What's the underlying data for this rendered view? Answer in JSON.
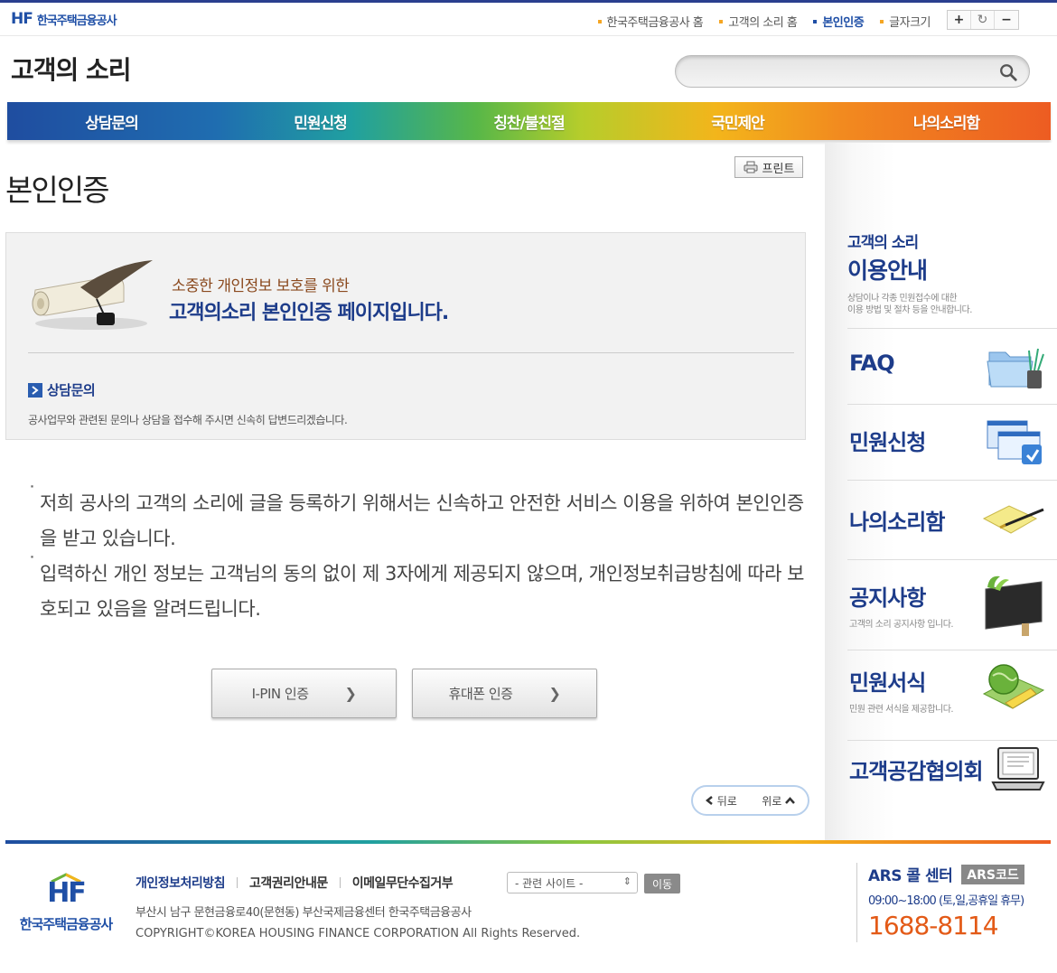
{
  "top": {
    "logo_mark": "HF",
    "logo_name": "한국주택금융공사",
    "utility": [
      {
        "label": "한국주택금융공사 홈",
        "active": false
      },
      {
        "label": "고객의 소리 홈",
        "active": false
      },
      {
        "label": "본인인증",
        "active": true
      },
      {
        "label": "글자크기",
        "active": false
      }
    ],
    "fontsize": {
      "plus": "+",
      "reset": "↻",
      "minus": "−"
    }
  },
  "header": {
    "title": "고객의 소리",
    "search_placeholder": ""
  },
  "gnb": [
    "상담문의",
    "민원신청",
    "칭찬/불친절",
    "국민제안",
    "나의소리함"
  ],
  "main": {
    "title": "본인인증",
    "print_label": "프린트",
    "info": {
      "line1": "소중한 개인정보 보호를 위한",
      "line2": "고객의소리 본인인증 페이지입니다.",
      "counsel_label": "상담문의",
      "counsel_desc": "공사업무와 관련된 문의나 상담을 접수해 주시면 신속히 답변드리겠습니다."
    },
    "notices": [
      "저희 공사의 고객의 소리에 글을 등록하기 위해서는 신속하고 안전한 서비스 이용을 위하여 본인인증을 받고 있습니다.",
      "입력하신 개인 정보는 고객님의 동의 없이 제 3자에게 제공되지 않으며, 개인정보취급방침에 따라 보호되고 있음을 알려드립니다."
    ],
    "buttons": {
      "ipin": "I-PIN 인증",
      "phone": "휴대폰 인증",
      "chevron": "❯"
    },
    "nav": {
      "back": "뒤로",
      "top": "위로"
    }
  },
  "side": {
    "guide": {
      "t1": "고객의 소리",
      "t2": "이용안내",
      "t3a": "상담이나 각종 민원접수에 대한",
      "t3b": "이용 방법 및 절차 등을 안내합니다."
    },
    "menu": [
      {
        "label": "FAQ",
        "sub": ""
      },
      {
        "label": "민원신청",
        "sub": ""
      },
      {
        "label": "나의소리함",
        "sub": ""
      },
      {
        "label": "공지사항",
        "sub": "고객의 소리 공지사항 입니다."
      },
      {
        "label": "민원서식",
        "sub": "민원 관련 서식을 제공합니다."
      },
      {
        "label": "고객공감협의회",
        "sub": ""
      }
    ]
  },
  "footer": {
    "logo_mark": "HF",
    "logo_name": "한국주택금융공사",
    "links": [
      "개인정보처리방침",
      "고객권리안내문",
      "이메일무단수집거부"
    ],
    "select_value": "- 관련 사이트 -",
    "go_label": "이동",
    "address": "부산시 남구 문현금융로40(문현동) 부산국제금융센터 한국주택금융공사",
    "copyright": "COPYRIGHT©KOREA HOUSING FINANCE CORPORATION All Rights Reserved.",
    "ars_label": "ARS 콜 센터",
    "ars_code": "ARS코드",
    "hours": "09:00~18:00 (토,일,공휴일 휴무)",
    "phone": "1688-8114"
  },
  "colors": {
    "brand": "#1d3c8a",
    "accent_orange": "#e35a17"
  }
}
